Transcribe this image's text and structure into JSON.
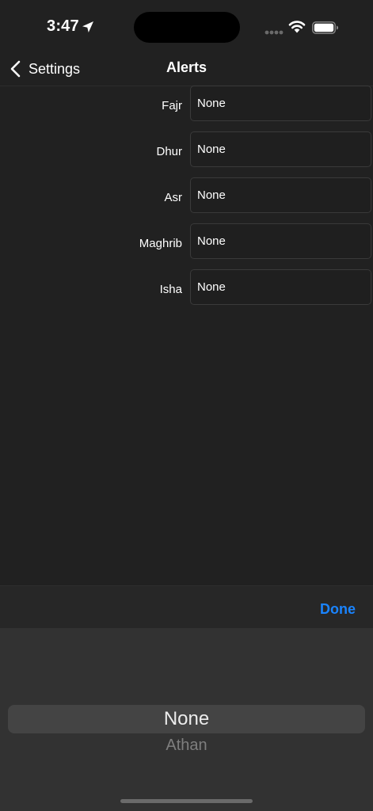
{
  "status_bar": {
    "time": "3:47"
  },
  "nav": {
    "back_label": "Settings",
    "title": "Alerts"
  },
  "alerts": [
    {
      "label": "Fajr",
      "value": "None"
    },
    {
      "label": "Dhur",
      "value": "None"
    },
    {
      "label": "Asr",
      "value": "None"
    },
    {
      "label": "Maghrib",
      "value": "None"
    },
    {
      "label": "Isha",
      "value": "None"
    }
  ],
  "picker": {
    "done_label": "Done",
    "selected_option": "None",
    "next_option": "Athan"
  },
  "colors": {
    "background": "#212121",
    "accent": "#1a84ff",
    "picker_background": "#323232"
  }
}
